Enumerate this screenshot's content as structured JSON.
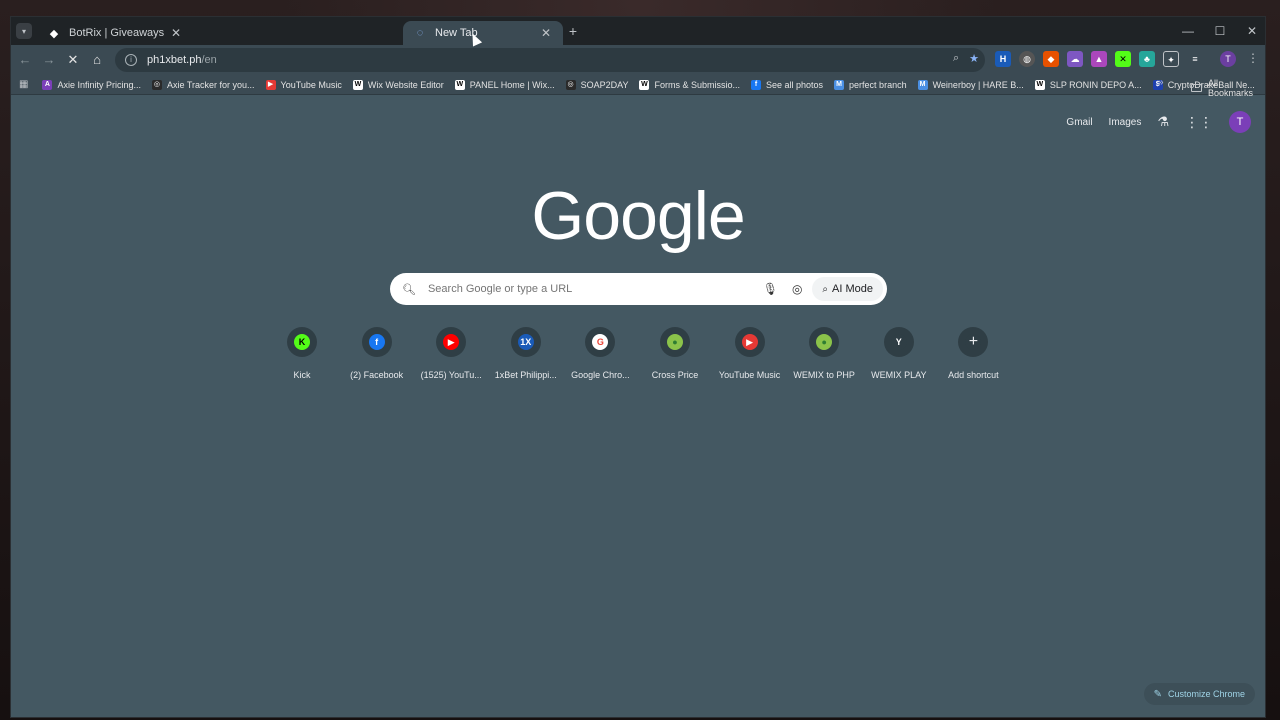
{
  "tabs": [
    {
      "title": "BotRix | Giveaways",
      "active": false
    },
    {
      "title": "New Tab",
      "active": true
    }
  ],
  "url": {
    "host": "ph1xbet.ph",
    "path": "/en"
  },
  "bookmarks": [
    {
      "label": "Axie Infinity Pricing...",
      "color": "#7b3fb8",
      "glyph": "A"
    },
    {
      "label": "Axie Tracker for you...",
      "color": "#2a2a2a",
      "glyph": "◎"
    },
    {
      "label": "YouTube Music",
      "color": "#e53935",
      "glyph": "▶"
    },
    {
      "label": "Wix Website Editor",
      "color": "#ffffff",
      "glyph": "W"
    },
    {
      "label": "PANEL Home | Wix...",
      "color": "#ffffff",
      "glyph": "W"
    },
    {
      "label": "SOAP2DAY",
      "color": "#2a2a2a",
      "glyph": "◎"
    },
    {
      "label": "Forms & Submissio...",
      "color": "#ffffff",
      "glyph": "W"
    },
    {
      "label": "See all photos",
      "color": "#1877f2",
      "glyph": "f"
    },
    {
      "label": "perfect branch",
      "color": "#4a8fe3",
      "glyph": "M"
    },
    {
      "label": "Weinerboy | HARE B...",
      "color": "#4a8fe3",
      "glyph": "M"
    },
    {
      "label": "SLP RONIN DEPO A...",
      "color": "#ffffff",
      "glyph": "W"
    },
    {
      "label": "CryptoDrakeBall Ne...",
      "color": "#1e40af",
      "glyph": "$"
    }
  ],
  "all_bookmarks_label": "All Bookmarks",
  "ntp": {
    "gmail": "Gmail",
    "images": "Images",
    "avatar_letter": "T",
    "logo": "Google",
    "search_placeholder": "Search Google or type a URL",
    "ai_mode": "AI Mode",
    "customize": "Customize Chrome"
  },
  "shortcuts": [
    {
      "label": "Kick",
      "glyph": "K",
      "color": "#53fc18",
      "text_color": "#000000"
    },
    {
      "label": "(2) Facebook",
      "glyph": "f",
      "color": "#1877f2",
      "text_color": "#ffffff"
    },
    {
      "label": "(1525) YouTu...",
      "glyph": "▶",
      "color": "#ff0000",
      "text_color": "#ffffff"
    },
    {
      "label": "1xBet Philippi...",
      "glyph": "1X",
      "color": "#1a5bb8",
      "text_color": "#ffffff"
    },
    {
      "label": "Google Chro...",
      "glyph": "G",
      "color": "#ffffff",
      "text_color": "#ea4335"
    },
    {
      "label": "Cross Price",
      "glyph": "●",
      "color": "#8bc34a",
      "text_color": "#2e7d32"
    },
    {
      "label": "YouTube Music",
      "glyph": "▶",
      "color": "#e53935",
      "text_color": "#ffffff"
    },
    {
      "label": "WEMIX to PHP",
      "glyph": "●",
      "color": "#8bc34a",
      "text_color": "#2e7d32"
    },
    {
      "label": "WEMIX PLAY",
      "glyph": "Y",
      "color": "#2f3e45",
      "text_color": "#ffffff"
    },
    {
      "label": "Add shortcut",
      "glyph": "+",
      "color": "#2f3e45",
      "text_color": "#e8eaed"
    }
  ],
  "profile_letter": "T"
}
